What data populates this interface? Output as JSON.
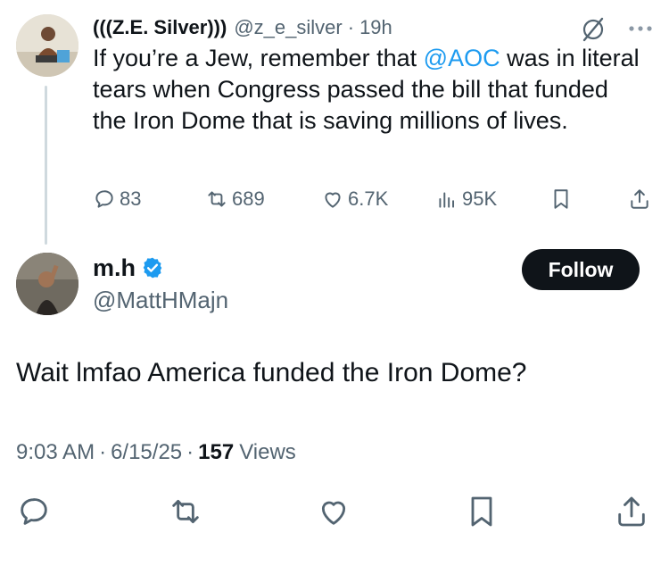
{
  "parent_tweet": {
    "display_name": "(((Z.E. Silver)))",
    "handle": "@z_e_silver",
    "separator": "·",
    "time": "19h",
    "text_before": "If you’re a Jew, remember that ",
    "mention": "@AOC",
    "text_after": " was in literal tears when Congress passed the bill that funded the Iron Dome that is saving millions of lives.",
    "actions": {
      "replies": "83",
      "reposts": "689",
      "likes": "6.7K",
      "views": "95K"
    }
  },
  "reply_tweet": {
    "display_name": "m.h",
    "handle": "@MattHMajn",
    "follow_label": "Follow",
    "text": "Wait lmfao America funded the Iron Dome?",
    "time": "9:03 AM",
    "separator": "·",
    "date": "6/15/25",
    "views_count": "157",
    "views_label": "Views"
  },
  "colors": {
    "text": "#0f1419",
    "secondary": "#536471",
    "link": "#1d9bf0",
    "follow_bg": "#0f1419"
  }
}
